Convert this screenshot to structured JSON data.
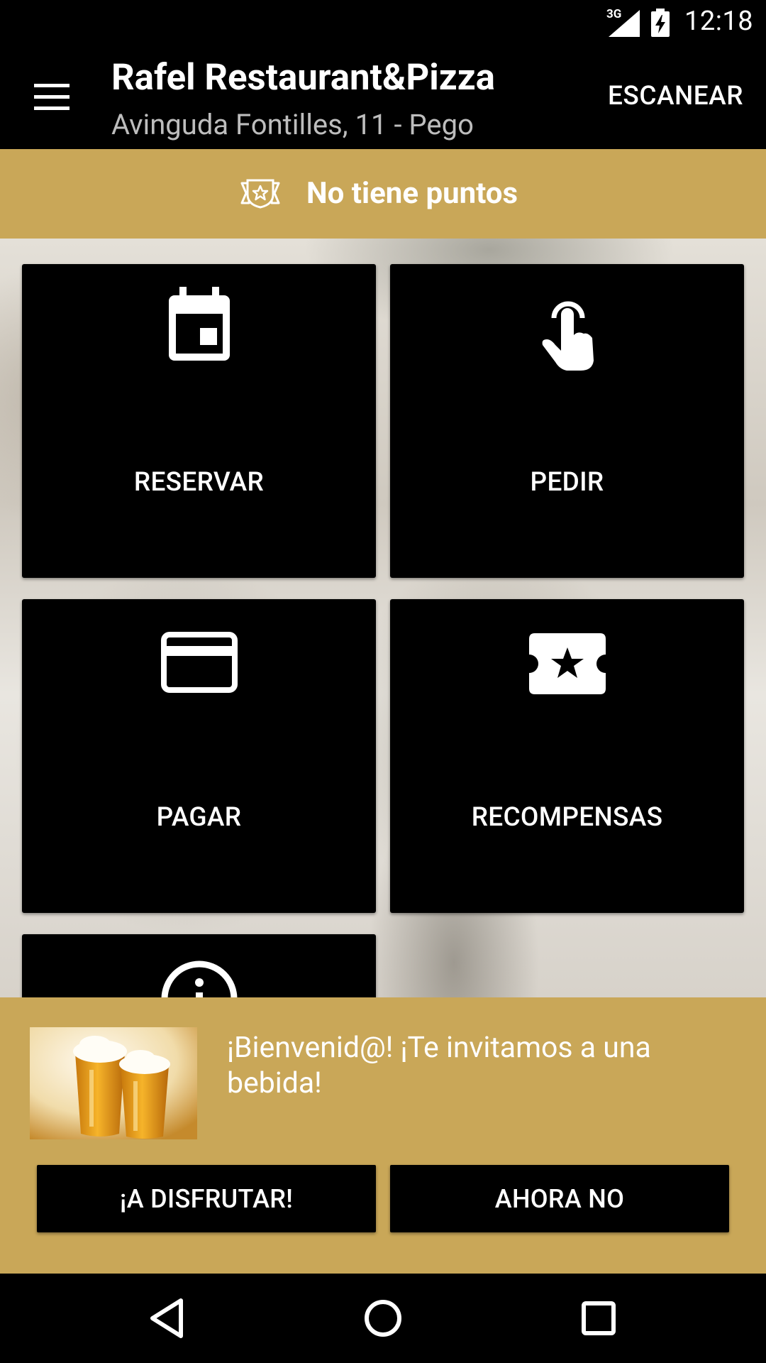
{
  "status_bar": {
    "network": "3G",
    "time": "12:18",
    "icons": [
      "signal-icon",
      "battery-charging-icon"
    ]
  },
  "app_bar": {
    "title": "Rafel Restaurant&Pizza",
    "subtitle": "Avinguda Fontilles, 11 - Pego",
    "action": "ESCANEAR",
    "menu_icon": "hamburger-menu-icon"
  },
  "points": {
    "label": "No tiene puntos",
    "icon": "badge-star-icon"
  },
  "tiles": [
    {
      "label": "RESERVAR",
      "icon": "calendar-icon"
    },
    {
      "label": "PEDIR",
      "icon": "touch-hand-icon"
    },
    {
      "label": "PAGAR",
      "icon": "credit-card-icon"
    },
    {
      "label": "RECOMPENSAS",
      "icon": "ticket-star-icon"
    },
    {
      "label": "",
      "icon": "info-icon"
    }
  ],
  "promo": {
    "message": "¡Bienvenid@! ¡Te invitamos a una bebida!",
    "image": "beer-glasses-image",
    "accept": "¡A DISFRUTAR!",
    "decline": "AHORA NO"
  },
  "nav": [
    "back-icon",
    "home-icon",
    "recents-icon"
  ],
  "colors": {
    "accent_gold": "#c9a758",
    "background": "#000000",
    "text": "#ffffff"
  }
}
